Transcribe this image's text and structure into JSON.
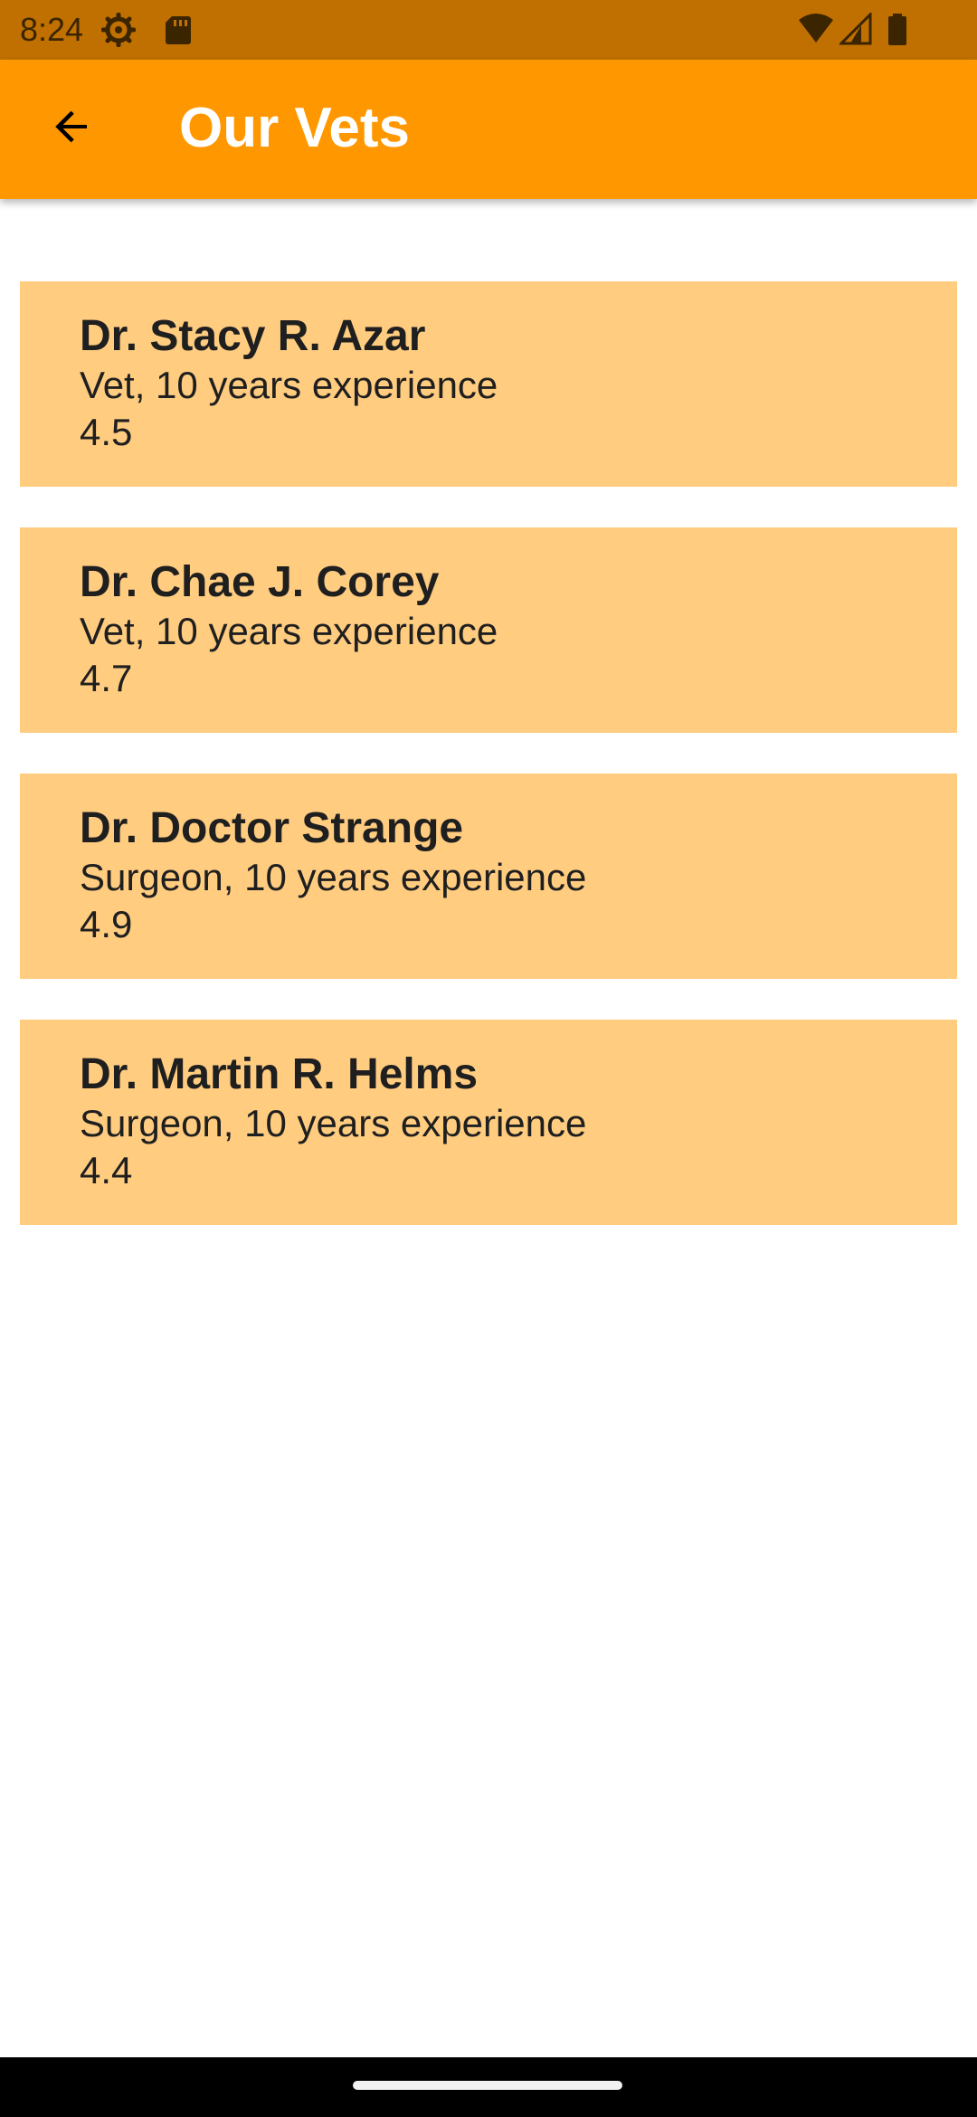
{
  "status_bar": {
    "time": "8:24",
    "icons": [
      "settings-icon",
      "sd-card-icon",
      "wifi-icon",
      "signal-icon",
      "battery-icon"
    ]
  },
  "app_bar": {
    "title": "Our Vets",
    "back_icon": "arrow-back-icon",
    "background_color": "#ff9800"
  },
  "vets": [
    {
      "name": "Dr. Stacy R. Azar",
      "description": "Vet, 10 years experience",
      "rating": "4.5"
    },
    {
      "name": "Dr. Chae J. Corey",
      "description": "Vet, 10 years experience",
      "rating": "4.7"
    },
    {
      "name": "Dr. Doctor Strange",
      "description": "Surgeon, 10 years experience",
      "rating": "4.9"
    },
    {
      "name": "Dr. Martin R. Helms",
      "description": "Surgeon, 10 years experience",
      "rating": "4.4"
    }
  ],
  "colors": {
    "status_bar": "#bf7000",
    "card_background": "#ffcc80",
    "text": "#1f1f1f"
  }
}
